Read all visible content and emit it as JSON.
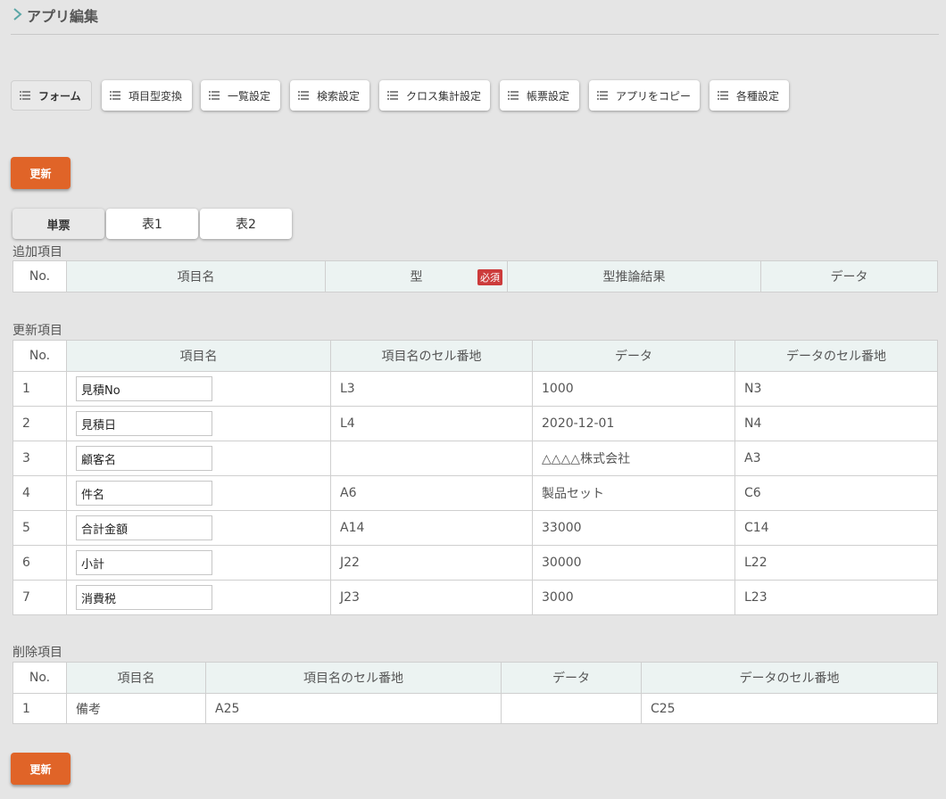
{
  "header": {
    "title": "アプリ編集"
  },
  "menu": [
    {
      "label": "フォーム",
      "icon": "list-icon"
    },
    {
      "label": "項目型変換",
      "icon": "list-icon"
    },
    {
      "label": "一覧設定",
      "icon": "list-icon"
    },
    {
      "label": "検索設定",
      "icon": "list-icon"
    },
    {
      "label": "クロス集計設定",
      "icon": "list-icon"
    },
    {
      "label": "帳票設定",
      "icon": "list-icon"
    },
    {
      "label": "アプリをコピー",
      "icon": "list-icon"
    },
    {
      "label": "各種設定",
      "icon": "list-icon"
    }
  ],
  "update_label": "更新",
  "tabs": [
    "単票",
    "表1",
    "表2"
  ],
  "add_section": {
    "label": "追加項目",
    "headers": [
      "No.",
      "項目名",
      "型",
      "型推論結果",
      "データ"
    ],
    "required_badge": "必須"
  },
  "update_section": {
    "label": "更新項目",
    "headers": [
      "No.",
      "項目名",
      "項目名のセル番地",
      "データ",
      "データのセル番地"
    ],
    "rows": [
      {
        "no": "1",
        "name": "見積No",
        "name_cell": "L3",
        "data": "1000",
        "data_cell": "N3"
      },
      {
        "no": "2",
        "name": "見積日",
        "name_cell": "L4",
        "data": "2020-12-01",
        "data_cell": "N4"
      },
      {
        "no": "3",
        "name": "顧客名",
        "name_cell": "",
        "data": "△△△△株式会社",
        "data_cell": "A3"
      },
      {
        "no": "4",
        "name": "件名",
        "name_cell": "A6",
        "data": "製品セット",
        "data_cell": "C6"
      },
      {
        "no": "5",
        "name": "合計金額",
        "name_cell": "A14",
        "data": "33000",
        "data_cell": "C14"
      },
      {
        "no": "6",
        "name": "小計",
        "name_cell": "J22",
        "data": "30000",
        "data_cell": "L22"
      },
      {
        "no": "7",
        "name": "消費税",
        "name_cell": "J23",
        "data": "3000",
        "data_cell": "L23"
      }
    ]
  },
  "delete_section": {
    "label": "削除項目",
    "headers": [
      "No.",
      "項目名",
      "項目名のセル番地",
      "データ",
      "データのセル番地"
    ],
    "rows": [
      {
        "no": "1",
        "name": "備考",
        "name_cell": "A25",
        "data": "",
        "data_cell": "C25"
      }
    ]
  },
  "colors": {
    "accent": "#e06428",
    "header_bg": "#ecf3f2",
    "badge": "#cc3b3b",
    "chevron": "#5aa6a6"
  }
}
